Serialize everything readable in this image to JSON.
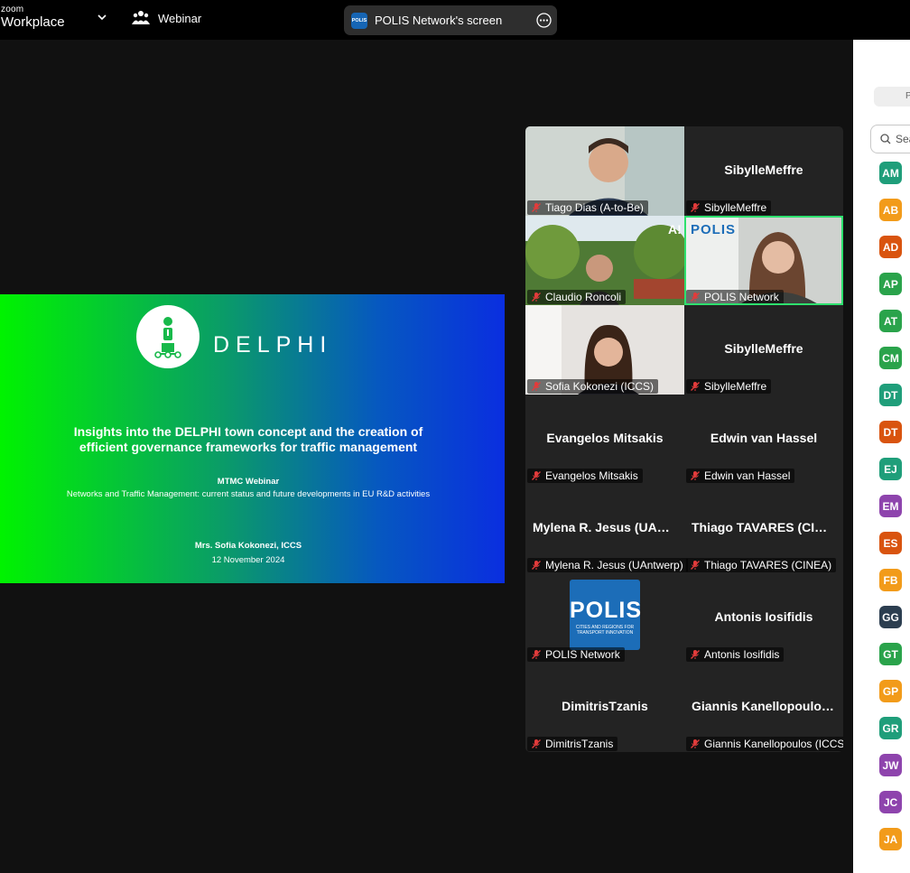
{
  "app": {
    "brand_small": "zoom",
    "brand_big": "Workplace",
    "mode": "Webinar"
  },
  "share": {
    "logo_text": "POLIS",
    "title": "POLIS Network's screen"
  },
  "slide": {
    "logo_word": "DELPHI",
    "title": "Insights into the DELPHI town concept and the creation of efficient governance frameworks for traffic management",
    "subtitle": "MTMC Webinar",
    "subtitle2": "Networks and Traffic Management: current status and future developments in EU R&D activities",
    "author": "Mrs. Sofia Kokonezi, ICCS",
    "date": "12 November 2024"
  },
  "gallery": [
    {
      "label": "Tiago Dias (A-to-Be)",
      "name": "",
      "video": "man",
      "bg": "#cfd6d1"
    },
    {
      "label": "SibylleMeffre",
      "name": "SibylleMeffre",
      "video": "",
      "bg": ""
    },
    {
      "label": "Claudio Roncoli",
      "name": "",
      "video": "outdoor",
      "bg": "#6d8a4a"
    },
    {
      "label": "POLIS Network",
      "name": "",
      "video": "woman",
      "bg": "#cfd2cf",
      "logo": "POLIS"
    },
    {
      "label": "Sofia Kokonezi (ICCS)",
      "name": "",
      "video": "woman2",
      "bg": "#e6e3e0"
    },
    {
      "label": "SibylleMeffre",
      "name": "SibylleMeffre",
      "video": "",
      "bg": ""
    },
    {
      "label": "Evangelos Mitsakis",
      "name": "Evangelos  Mitsakis",
      "video": "",
      "bg": ""
    },
    {
      "label": "Edwin van Hassel",
      "name": "Edwin van Hassel",
      "video": "",
      "bg": ""
    },
    {
      "label": "Mylena R. Jesus (UAntwerp)",
      "name": "Mylena R. Jesus (UAntwerp)",
      "video": "",
      "bg": ""
    },
    {
      "label": "Thiago TAVARES (CINEA)",
      "name": "Thiago  TAVARES (CINEA)",
      "video": "",
      "bg": ""
    },
    {
      "label": "POLIS Network",
      "name": "",
      "video": "polis-logo",
      "bg": "",
      "logo": "POLIS",
      "logo_sub": "CITIES AND REGIONS FOR TRANSPORT INNOVATION"
    },
    {
      "label": "Antonis Iosifidis",
      "name": "Antonis Iosifidis",
      "video": "",
      "bg": ""
    },
    {
      "label": "DimitrisTzanis",
      "name": "DimitrisTzanis",
      "video": "",
      "bg": ""
    },
    {
      "label": "Giannis Kanellopoulos (ICCS)",
      "name": "Giannis  Kanellopoulos (ICCS)",
      "video": "",
      "bg": ""
    }
  ],
  "panel": {
    "tab_initial": "P",
    "search_placeholder": "Search",
    "avatars": [
      {
        "initials": "AM",
        "color": "#1f9e7a"
      },
      {
        "initials": "AB",
        "color": "#f29b1a"
      },
      {
        "initials": "AD",
        "color": "#d9540f"
      },
      {
        "initials": "AP",
        "color": "#2aa34b"
      },
      {
        "initials": "AT",
        "color": "#2aa34b"
      },
      {
        "initials": "CM",
        "color": "#2aa34b"
      },
      {
        "initials": "DT",
        "color": "#1f9e7a"
      },
      {
        "initials": "DT",
        "color": "#d9540f"
      },
      {
        "initials": "EJ",
        "color": "#1f9e7a"
      },
      {
        "initials": "EM",
        "color": "#8e44ad"
      },
      {
        "initials": "ES",
        "color": "#d9540f"
      },
      {
        "initials": "FB",
        "color": "#f29b1a"
      },
      {
        "initials": "GG",
        "color": "#2c3e50"
      },
      {
        "initials": "GT",
        "color": "#2aa34b"
      },
      {
        "initials": "GP",
        "color": "#f29b1a"
      },
      {
        "initials": "GR",
        "color": "#1f9e7a"
      },
      {
        "initials": "JW",
        "color": "#8e44ad"
      },
      {
        "initials": "JC",
        "color": "#8e44ad"
      },
      {
        "initials": "JA",
        "color": "#f29b1a"
      }
    ]
  }
}
